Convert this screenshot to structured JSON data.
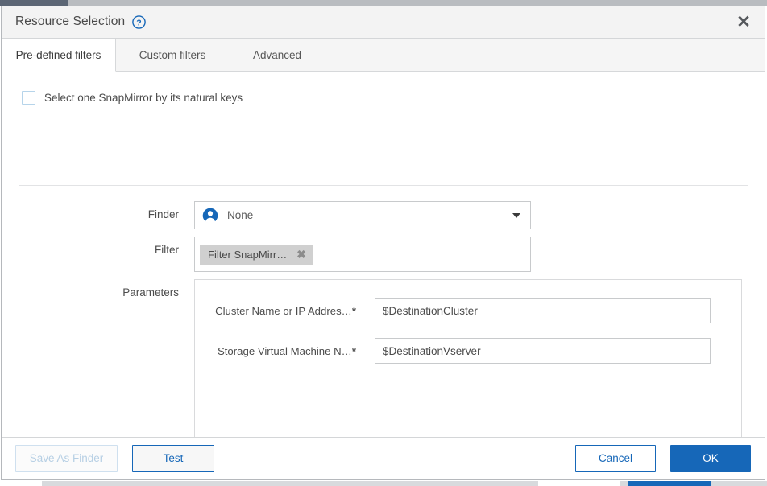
{
  "dialog": {
    "title": "Resource Selection",
    "help_icon": "help-circle-icon",
    "close_icon": "close-icon",
    "close_label": "✕"
  },
  "tabs": [
    {
      "label": "Pre-defined filters",
      "active": true
    },
    {
      "label": "Custom filters",
      "active": false
    },
    {
      "label": "Advanced",
      "active": false
    }
  ],
  "checkbox": {
    "label": "Select one SnapMirror by its natural keys",
    "checked": false
  },
  "form": {
    "finder": {
      "label": "Finder",
      "value": "None",
      "icon": "user-avatar-icon",
      "caret_icon": "chevron-down-icon"
    },
    "filter": {
      "label": "Filter",
      "chip_text": "Filter SnapMirr…",
      "chip_remove_icon": "close-small-icon",
      "chip_remove_label": "✖"
    },
    "parameters": {
      "label": "Parameters",
      "items": [
        {
          "label": "Cluster Name or IP Addres…",
          "required_marker": "*",
          "value": "$DestinationCluster",
          "placeholder": ""
        },
        {
          "label": "Storage Virtual Machine N…",
          "required_marker": "*",
          "value": "$DestinationVserver",
          "placeholder": ""
        }
      ]
    }
  },
  "footer": {
    "save_as_finder": "Save As Finder",
    "test": "Test",
    "cancel": "Cancel",
    "ok": "OK"
  },
  "colors": {
    "accent_blue": "#1667b8",
    "titlebar_bg": "#f3f3f3",
    "tabbar_bg": "#f5f5f5",
    "chip_bg": "#d0d0d0",
    "border": "#c8cacc"
  }
}
